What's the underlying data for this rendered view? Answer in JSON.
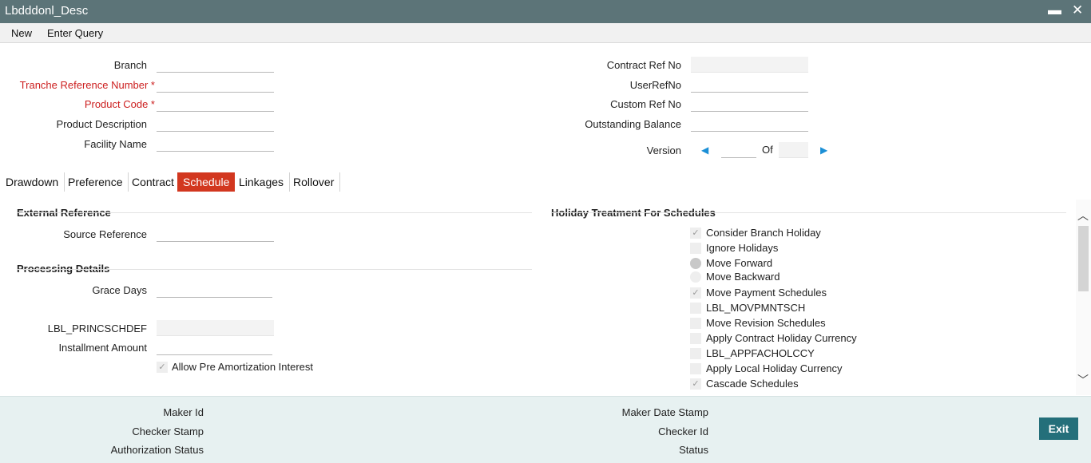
{
  "window": {
    "title": "Lbdddonl_Desc",
    "minimize": "▬",
    "close": "✕"
  },
  "menu": {
    "new": "New",
    "enter_query": "Enter Query"
  },
  "header": {
    "branch_label": "Branch",
    "tranche_label": "Tranche Reference Number *",
    "product_code_label": "Product Code *",
    "product_desc_label": "Product Description",
    "facility_label": "Facility Name",
    "contract_ref_label": "Contract Ref No",
    "userref_label": "UserRefNo",
    "custom_ref_label": "Custom Ref No",
    "outstanding_label": "Outstanding Balance",
    "version_label": "Version",
    "version_of": "Of",
    "prev_arrow": "◀",
    "next_arrow": "▶"
  },
  "tabs": [
    {
      "label": "Drawdown"
    },
    {
      "label": "Preference"
    },
    {
      "label": "Contract"
    },
    {
      "label": "Schedule"
    },
    {
      "label": "Linkages"
    },
    {
      "label": "Rollover"
    }
  ],
  "schedule": {
    "external_reference_head": "External Reference",
    "source_reference_label": "Source Reference",
    "processing_details_head": "Processing Details",
    "grace_days_label": "Grace Days",
    "princschdef_label": "LBL_PRINCSCHDEF",
    "installment_label": "Installment Amount",
    "allow_pre_amort_label": "Allow Pre Amortization Interest",
    "holiday_head": "Holiday Treatment For Schedules",
    "holiday_options": [
      {
        "label": "Consider Branch Holiday"
      },
      {
        "label": "Ignore Holidays"
      },
      {
        "label": "Move Forward"
      },
      {
        "label": "Move Backward"
      },
      {
        "label": "Move Payment Schedules"
      },
      {
        "label": "LBL_MOVPMNTSCH"
      },
      {
        "label": "Move Revision Schedules"
      },
      {
        "label": "Apply Contract Holiday Currency"
      },
      {
        "label": "LBL_APPFACHOLCCY"
      },
      {
        "label": "Apply Local Holiday Currency"
      },
      {
        "label": "Cascade Schedules"
      }
    ]
  },
  "scroll": {
    "up": "︿",
    "down": "﹀"
  },
  "footer": {
    "maker_id": "Maker Id",
    "checker_stamp": "Checker Stamp",
    "auth_status": "Authorization Status",
    "maker_date_stamp": "Maker Date Stamp",
    "checker_id": "Checker Id",
    "status": "Status",
    "exit": "Exit"
  },
  "checkmark": "✓"
}
